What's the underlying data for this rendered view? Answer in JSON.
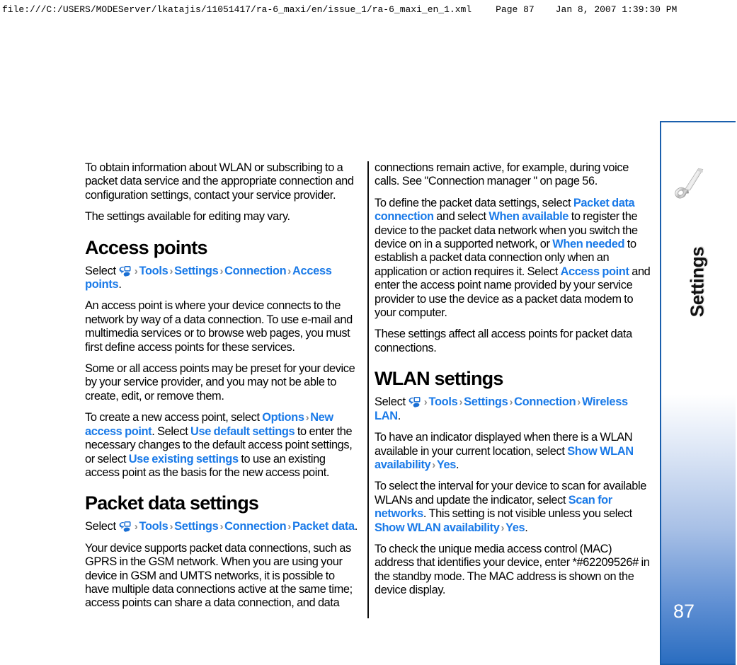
{
  "print_header": {
    "url": "file:///C:/USERS/MODEServer/lkatajis/11051417/ra-6_maxi/en/issue_1/ra-6_maxi_en_1.xml",
    "page": "Page 87",
    "date": "Jan 8, 2007 1:39:30 PM"
  },
  "colors": {
    "command_blue": "#1a7ae8",
    "separator_gray": "#8c8c8c",
    "tab_border_blue": "#1a5fad",
    "tab_gradient_bottom": "#2a6dc0"
  },
  "sidebar": {
    "label": "Settings",
    "page_number": "87",
    "icon": "wrench-icon"
  },
  "left_column": {
    "para_1": "To obtain information about WLAN or subscribing to a packet data service and the appropriate connection and configuration settings, contact your service provider.",
    "para_2": "The settings available for editing may vary.",
    "heading_access_points": "Access points",
    "select_access_points": {
      "lead": "Select",
      "icon": "menu-icon",
      "crumbs": [
        "Tools",
        "Settings",
        "Connection",
        "Access points"
      ],
      "separator": "›",
      "trailing": "."
    },
    "para_3": "An access point is where your device connects to the network by way of a data connection. To use e-mail and multimedia services or to browse web pages, you must first define access points for these services.",
    "para_4": "Some or all access points may be preset for your device by your service provider, and you may not be able to create, edit, or remove them.",
    "para_5": {
      "t1": "To create a new access point, select ",
      "c1": "Options",
      "sep1": "›",
      "c2": "New access point",
      "t2": ". Select ",
      "c3": "Use default settings",
      "t3": " to enter the necessary changes to the default access point settings, or select ",
      "c4": "Use existing settings",
      "t4": " to use an existing access point as the basis for the new access point."
    },
    "heading_packet_data": "Packet data settings",
    "select_packet_data": {
      "lead": "Select",
      "icon": "menu-icon",
      "crumbs": [
        "Tools",
        "Settings",
        "Connection",
        "Packet data"
      ],
      "separator": "›",
      "trailing": "."
    },
    "para_6": "Your device supports packet data connections, such as GPRS in the GSM network. When you are using your device in GSM and UMTS networks, it is possible to have multiple data connections active at the same time; access points can share a data connection, and data"
  },
  "right_column": {
    "para_1": "connections remain active, for example, during voice calls. See \"Connection manager \" on page 56.",
    "para_2": {
      "t1": "To define the packet data settings, select ",
      "c1": "Packet data connection",
      "t2": " and select ",
      "c2": "When available",
      "t3": " to register the device to the packet data network when you switch the device on in a supported network, or ",
      "c3": "When needed",
      "t4": " to establish a packet data connection only when an application or action requires it. Select ",
      "c4": "Access point",
      "t5": " and enter the access point name provided by your service provider to use the device as a packet data modem to your computer."
    },
    "para_3": "These settings affect all access points for packet data connections.",
    "heading_wlan": "WLAN settings",
    "select_wlan": {
      "lead": "Select",
      "icon": "menu-icon",
      "crumbs": [
        "Tools",
        "Settings",
        "Connection",
        "Wireless LAN"
      ],
      "separator": "›",
      "trailing": "."
    },
    "para_4": {
      "t1": "To have an indicator displayed when there is a WLAN available in your current location, select ",
      "c1": "Show WLAN availability",
      "sep1": "›",
      "c2": "Yes",
      "t2": "."
    },
    "para_5": {
      "t1": "To select the interval for your device to scan for available WLANs and update the indicator, select ",
      "c1": "Scan for networks",
      "t2": ". This setting is not visible unless you select ",
      "c2": "Show WLAN availability",
      "sep1": "›",
      "c3": "Yes",
      "t3": "."
    },
    "para_6": "To check the unique media access control (MAC) address that identifies your device, enter *#62209526# in the standby mode. The MAC address is shown on the device display."
  }
}
